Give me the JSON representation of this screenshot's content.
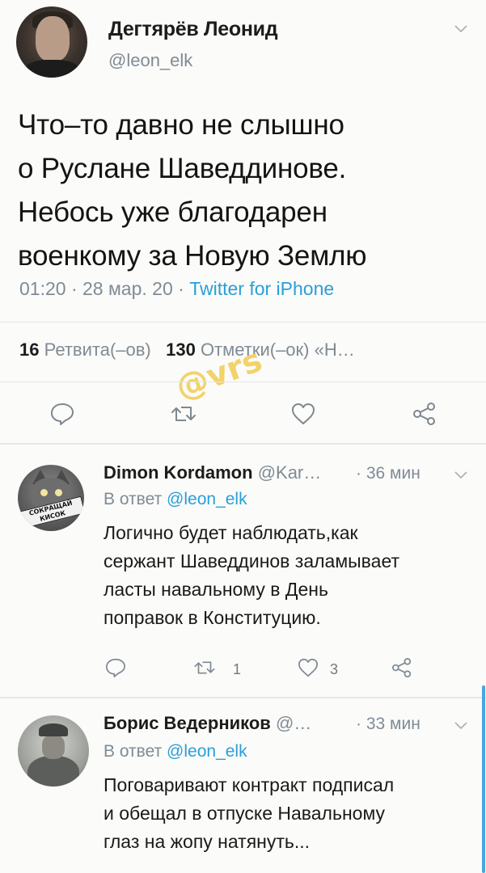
{
  "main_tweet": {
    "author_name": "Дегтярёв Леонид",
    "author_handle": "@leon_elk",
    "text_lines": [
      "Что–то давно не слышно",
      "о Руслане Шаведдинове.",
      "Небось уже благодарен",
      "военкому за Новую Землю"
    ],
    "time": "01:20",
    "date": "28 мар. 20",
    "separator": "·",
    "source": "Twitter for iPhone",
    "retweets_count": "16",
    "retweets_label": "Ретвита(–ов)",
    "likes_count": "130",
    "likes_label": "Отметки(–ок)",
    "quotes_label": "«Н…",
    "watermark": "@vrs"
  },
  "replies": [
    {
      "name": "Dimon Kordamon",
      "handle": "@Kar…",
      "time": "· 36 мин",
      "reply_prefix": "В ответ",
      "reply_mention": "@leon_elk",
      "text_lines": [
        "Логично будет наблюдать,как",
        "сержант Шаведдинов заламывает",
        "ласты навальному в День",
        "поправок в Конституцию."
      ],
      "retweets": "1",
      "likes": "3",
      "avatar_text": "СОКРАЩАЙ КИСОК"
    },
    {
      "name": "Борис Ведерников",
      "handle": "@…",
      "time": "· 33 мин",
      "reply_prefix": "В ответ",
      "reply_mention": "@leon_elk",
      "text_lines": [
        "Поговаривают контракт подписал",
        "и обещал в отпуске  Навальному",
        "глаз на жопу натянуть..."
      ]
    }
  ],
  "colors": {
    "link": "#2a9fd8",
    "muted": "#7f8b95",
    "watermark": "#f2d36b"
  }
}
